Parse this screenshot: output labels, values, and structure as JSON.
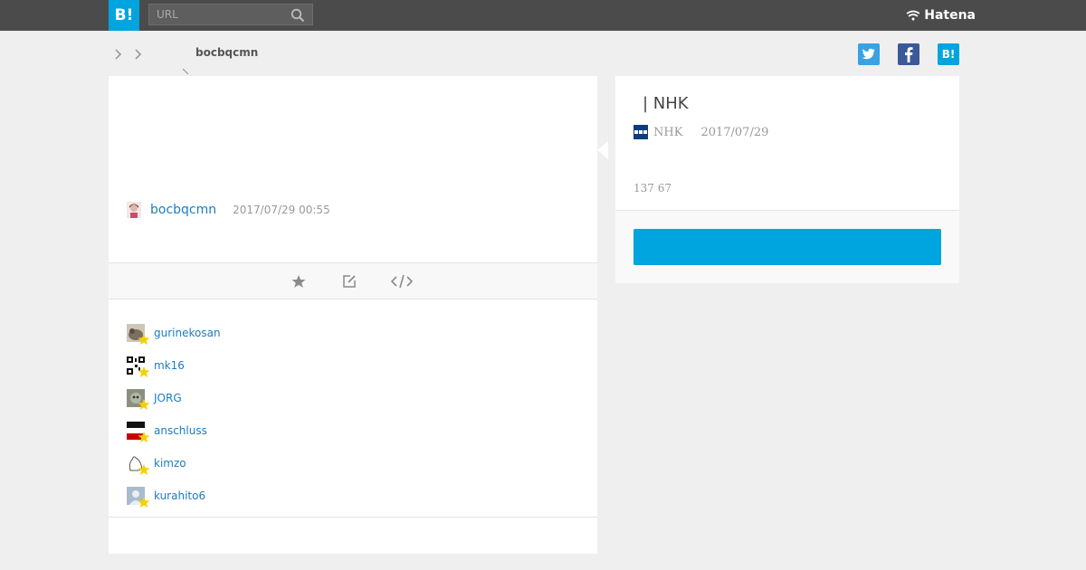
{
  "topbar": {
    "logo_label": "B!",
    "search": {
      "placeholder": "URL",
      "value": ""
    },
    "brand_label": "Hatena"
  },
  "breadcrumb": {
    "user": "bocbqcmn"
  },
  "comment": {
    "user": "bocbqcmn",
    "timestamp": "2017/07/29 00:55"
  },
  "actions": {
    "icons": [
      "star-icon",
      "edit-icon",
      "embed-code-icon"
    ]
  },
  "stars": [
    {
      "user": "gurinekosan",
      "avatar_color": "#7b6f5e"
    },
    {
      "user": "mk16",
      "avatar_color": "#111111"
    },
    {
      "user": "JORG",
      "avatar_color": "#8a8f80"
    },
    {
      "user": "anschluss",
      "avatar_color": "#cc0000"
    },
    {
      "user": "kimzo",
      "avatar_color": "#dddddd"
    },
    {
      "user": "kurahito6",
      "avatar_color": "#a9bccd"
    }
  ],
  "entry": {
    "title": "| NHK",
    "site": "NHK",
    "date": "2017/07/29",
    "counts": "137 67",
    "bookmark_button": ""
  },
  "colors": {
    "accent": "#00a4de",
    "link": "#1b7dbe",
    "topbar": "#4b4b4b",
    "star": "#f5d000"
  }
}
